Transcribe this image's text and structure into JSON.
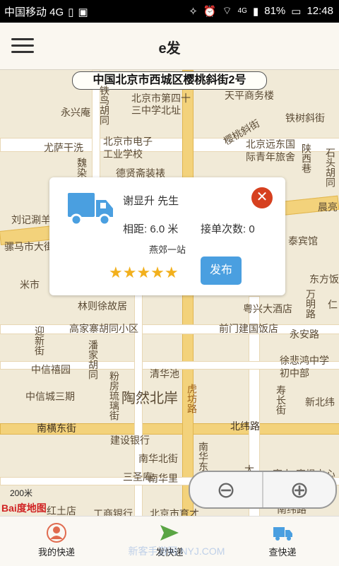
{
  "status_bar": {
    "carrier": "中国移动 4G",
    "battery": "81%",
    "time": "12:48",
    "signal_label": "4G"
  },
  "app": {
    "title": "e发"
  },
  "map": {
    "address": "中国北京市西城区樱桃斜街2号",
    "labels": [
      "铁鸟胡同",
      "北京市第四十三中学北址",
      "天平商务楼",
      "永兴庵",
      "铁树斜街",
      "樱桃斜街",
      "北京远东国际青年旅舍",
      "陕西巷",
      "石头胡同",
      "北京市电子工业学校",
      "尤萨干洗",
      "魏染胡同",
      "德贤斋装裱",
      "刘记涮羊",
      "晨亮",
      "骡马市大街",
      "泰宾馆",
      "米市",
      "东方饭",
      "林则徐故居",
      "高家寨胡同小区",
      "万明路",
      "迎新街",
      "粤兴大酒店",
      "前门建国饭店",
      "永安路",
      "仁",
      "中信禧园",
      "潘家胡同",
      "徐悲鸿中学初中部",
      "中信城三期",
      "清华池",
      "粉房琉璃街",
      "陶然北岸",
      "虎坊路",
      "寿长街",
      "新北纬",
      "南横东街",
      "北纬路",
      "建设银行",
      "南华北街",
      "三圣庵",
      "南华东",
      "南华里",
      "太",
      "红土店",
      "工商银行",
      "北京市育才",
      "富力·摩根中心",
      "南纬路"
    ],
    "scale": "200米",
    "baidu_logo": "Bai度地图"
  },
  "card": {
    "name": "谢显升   先生",
    "distance": "相距: 6.0 米",
    "orders": "接单次数: 0",
    "station": "燕郊一站",
    "rating": 5,
    "stars": "★★★★★",
    "publish_label": "发布",
    "close_symbol": "✕"
  },
  "zoom": {
    "out_label": "⊖",
    "in_label": "⊕"
  },
  "tabs": [
    {
      "label": "我的快递",
      "icon": "user-icon"
    },
    {
      "label": "发快递",
      "icon": "send-icon"
    },
    {
      "label": "查快递",
      "icon": "truck-icon"
    }
  ],
  "watermark": "新客手游网 NYJ.COM",
  "colors": {
    "accent": "#4a9fe0",
    "close": "#d6401f",
    "star": "#f2b01d",
    "map_bg": "#f1ead7",
    "road_yellow": "#f3d27b"
  }
}
